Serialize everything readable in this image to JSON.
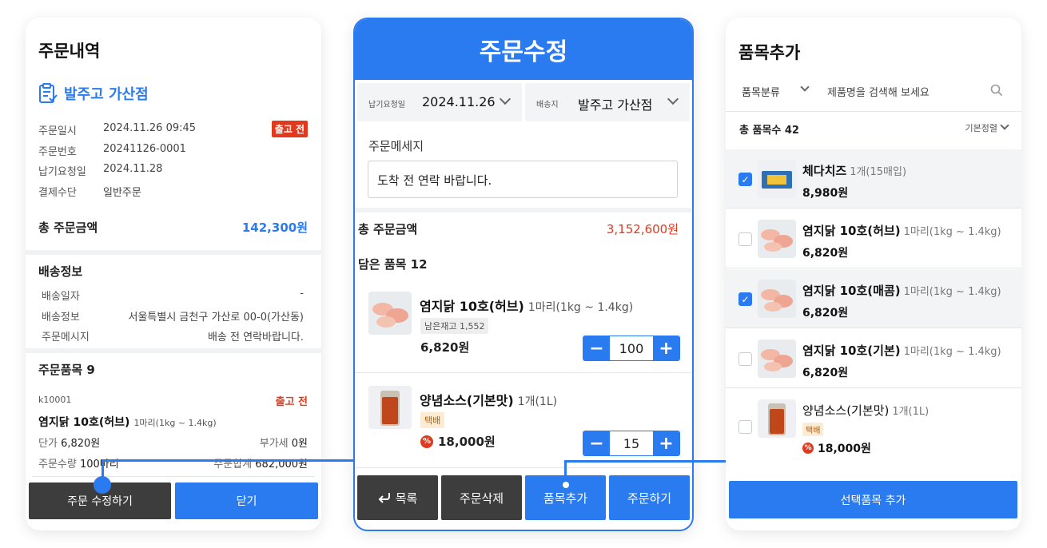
{
  "left": {
    "title": "주문내역",
    "store_name": "발주고 가산점",
    "info": [
      {
        "label": "주문일시",
        "value": "2024.11.26 09:45"
      },
      {
        "label": "주문번호",
        "value": "20241126-0001"
      },
      {
        "label": "납기요청일",
        "value": "2024.11.28"
      },
      {
        "label": "결제수단",
        "value": "일반주문"
      }
    ],
    "status_badge": "출고 전",
    "total_label": "총 주문금액",
    "total_value": "142,300원",
    "shipping_title": "배송정보",
    "shipping": [
      {
        "label": "배송일자",
        "value": "-"
      },
      {
        "label": "배송정보",
        "value": "서울특별시 금천구 가산로 00-0(가산동)"
      },
      {
        "label": "주문메시지",
        "value": "배송 전 연락바랍니다."
      }
    ],
    "items_title": "주문품목 9",
    "item": {
      "code": "k10001",
      "status": "출고 전",
      "name": "염지닭 10호(허브)",
      "unit": "1마리(1kg ~ 1.4kg)",
      "price_label": "단가",
      "price": "6,820원",
      "vat_label": "부가세",
      "vat": "0원",
      "qty_label": "주문수량",
      "qty": "100마리",
      "sum_label": "주문합계",
      "sum": "682,000원"
    },
    "btn_edit": "주문 수정하기",
    "btn_close": "닫기"
  },
  "middle": {
    "header": "주문수정",
    "date_label": "납기요청일",
    "date_value": "2024.11.26",
    "dest_label": "배송지",
    "dest_value": "발주고 가산점",
    "message_label": "주문메세지",
    "message_value": "도착 전 연락 바랍니다.",
    "total_label": "총 주문금액",
    "total_value": "3,152,600원",
    "items_count": "담은 품목 12",
    "items": [
      {
        "name": "염지닭 10호(허브)",
        "unit": "1마리(1kg ~ 1.4kg)",
        "tag": "남은재고 1,552",
        "price": "6,820원",
        "qty": "100"
      },
      {
        "name": "양념소스(기본맛)",
        "unit": "1개(1L)",
        "tag": "택배",
        "price": "18,000원",
        "qty": "15"
      }
    ],
    "stepper_minus": "−",
    "stepper_plus": "+",
    "sale_mark": "%",
    "btn_list": "목록",
    "btn_delete": "주문삭제",
    "btn_add": "품목추가",
    "btn_order": "주문하기"
  },
  "right": {
    "title": "품목추가",
    "category": "품목분류",
    "search_placeholder": "제품명을 검색해 보세요",
    "count": "총 품목수 42",
    "sort": "기본정렬",
    "products": [
      {
        "name": "체다치즈",
        "unit": "1개(15매입)",
        "price": "8,980원",
        "checked": true
      },
      {
        "name": "염지닭 10호(허브)",
        "unit": "1마리(1kg ~ 1.4kg)",
        "price": "6,820원",
        "checked": false
      },
      {
        "name": "염지닭 10호(매콤)",
        "unit": "1마리(1kg ~ 1.4kg)",
        "price": "6,820원",
        "checked": true
      },
      {
        "name": "염지닭 10호(기본)",
        "unit": "1마리(1kg ~ 1.4kg)",
        "price": "6,820원",
        "checked": false
      },
      {
        "name": "양념소스(기본맛)",
        "unit": "1개(1L)",
        "tag": "택배",
        "price": "18,000원",
        "checked": false
      }
    ],
    "check_mark": "✓",
    "btn_add_selected": "선택품목 추가"
  },
  "colors": {
    "accent": "#2b7bf0",
    "danger": "#e0391e",
    "dark_button": "#3d3d3d"
  }
}
